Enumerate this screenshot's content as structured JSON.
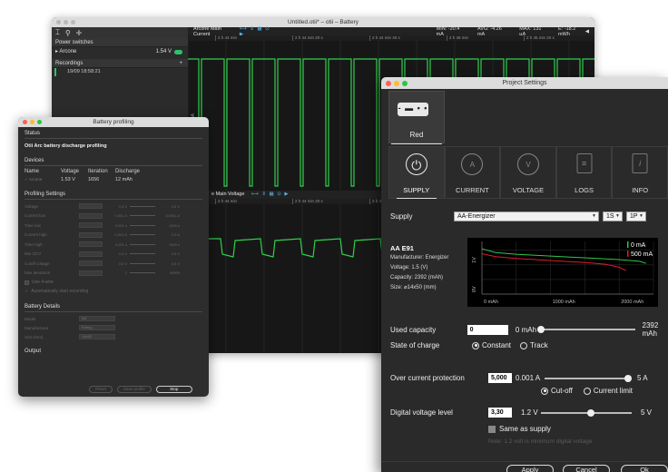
{
  "main_window": {
    "title": "Untitled.otii* – otii – Battery",
    "toolbar_icons": [
      "cursor-icon",
      "zoom-icon",
      "crosshair-icon"
    ],
    "channel1_title": "Arcone Main Current",
    "channel1_controls": "⟷ ⇕ ▦ ⊙ ▶",
    "stats": {
      "min": "MIN: -20.4 mA",
      "avg": "AVG: -4.26 mA",
      "max": "MAX: 131 µA",
      "energy": "E: -18.2 mWh"
    },
    "time_ticks": [
      "2 h 44 min",
      "2 h 44 min 20 s",
      "2 h 44 min 40 s",
      "2 h 45 min",
      "2 h 45 min 20 s"
    ],
    "channel1_axis_label": "10 mA",
    "channel2_title": "Arcone Main Voltage",
    "channel2_visible": "e Main Voltage",
    "power_switches": "Power switches",
    "device_name": "Arcone",
    "device_voltage": "1.54 V",
    "recordings": "Recordings",
    "recording_item": "19/09 18:58:21",
    "add_symbol": "+"
  },
  "battery_profiling": {
    "title": "Battery profiling",
    "status_title": "Status",
    "status_text": "Otii Arc battery discharge profiling",
    "devices_title": "Devices",
    "device_headers": [
      "Name",
      "Voltage",
      "Iteration",
      "Discharge"
    ],
    "device_row": [
      "Arcone",
      "1.53 V",
      "1656",
      "12 mAh"
    ],
    "settings_title": "Profiling Settings",
    "settings": [
      {
        "label": "Voltage",
        "min": "0.5 V",
        "max": "4.5 V"
      },
      {
        "label": "Current low",
        "min": "0.001 A",
        "max": "0.0001 A"
      },
      {
        "label": "Time low",
        "min": "0.001 s",
        "max": "1000 s"
      },
      {
        "label": "Current high",
        "min": "0.001 A",
        "max": "2.5 A"
      },
      {
        "label": "Time high",
        "min": "0.001 s",
        "max": "1000 s"
      },
      {
        "label": "Min OCV",
        "min": "0.5 V",
        "max": "4.5 V"
      },
      {
        "label": "Cutoff voltage",
        "min": "0.5 V",
        "max": "4.5 V"
      },
      {
        "label": "Max iterations",
        "min": "1",
        "max": "99999"
      }
    ],
    "use_4wire": "Use 4-wire",
    "auto_start": "Automatically start recording",
    "details_title": "Battery Details",
    "details": [
      {
        "label": "Model",
        "placeholder": "AA"
      },
      {
        "label": "Manufacturer",
        "placeholder": "Energ..."
      },
      {
        "label": "Size (mm)",
        "placeholder": "14x50"
      }
    ],
    "output_title": "Output",
    "btn_reset": "Reset",
    "btn_save": "Save profile",
    "btn_stop": "Stop"
  },
  "project_settings": {
    "title": "Project Settings",
    "device_card_label": "Red",
    "device_card_icon": "- ▬ • •",
    "tabs": [
      {
        "label": "SUPPLY",
        "icon": "power-icon",
        "glyph": "⏻"
      },
      {
        "label": "CURRENT",
        "icon": "current-icon",
        "glyph": "A"
      },
      {
        "label": "VOLTAGE",
        "icon": "voltage-icon",
        "glyph": "V"
      },
      {
        "label": "LOGS",
        "icon": "logs-icon",
        "glyph": "≡"
      },
      {
        "label": "INFO",
        "icon": "info-icon",
        "glyph": "i"
      }
    ],
    "supply_label": "Supply",
    "supply_value": "AA-Energizer",
    "series_value": "1S",
    "parallel_value": "1P",
    "battery": {
      "name": "AA E91",
      "manufacturer": "Manufacturer: Energizer",
      "voltage": "Voltage: 1.5 (V)",
      "capacity": "Capacity: 2392 (mAh)",
      "size": "Size: ⌀14x50 (mm)"
    },
    "used_capacity_label": "Used capacity",
    "used_capacity_value": "0",
    "used_capacity_min": "0 mAh",
    "used_capacity_max": "2392 mAh",
    "used_capacity_fraction": 0.0,
    "state_of_charge_label": "State of charge",
    "soc_options": [
      "Constant",
      "Track"
    ],
    "ocp_label": "Over current protection",
    "ocp_value": "5,000",
    "ocp_min": "0.001 A",
    "ocp_max": "5 A",
    "ocp_fraction": 1.0,
    "ocp_modes": [
      "Cut-off",
      "Current limit"
    ],
    "dv_label": "Digital voltage level",
    "dv_value": "3,30",
    "dv_min": "1.2 V",
    "dv_max": "5 V",
    "dv_fraction": 0.55,
    "same_as_supply": "Same as supply",
    "note": "Note: 1.2 volt is minimum digital voltage",
    "btn_apply": "Apply",
    "btn_cancel": "Cancel",
    "btn_ok": "Ok"
  },
  "chart_data": {
    "type": "line",
    "title": "",
    "xlabel": "",
    "ylabel": "",
    "x_ticks": [
      "0 mAh",
      "1000 mAh",
      "2000 mAh"
    ],
    "y_ticks": [
      "0V",
      "1V"
    ],
    "series": [
      {
        "name": "0 mA",
        "color": "#2ec84a",
        "x": [
          0,
          200,
          500,
          1000,
          1500,
          2000,
          2300,
          2392
        ],
        "y": [
          1.55,
          1.42,
          1.36,
          1.3,
          1.24,
          1.18,
          1.12,
          1.05
        ]
      },
      {
        "name": "500 mA",
        "color": "#e01b2a",
        "x": [
          0,
          200,
          500,
          1000,
          1500,
          1800,
          2000,
          2100
        ],
        "y": [
          1.38,
          1.28,
          1.22,
          1.15,
          1.08,
          1.02,
          0.92,
          0.8
        ]
      }
    ],
    "xlim": [
      0,
      2500
    ],
    "ylim": [
      0,
      1.8
    ],
    "legend_position": "top-right",
    "grid": true
  }
}
